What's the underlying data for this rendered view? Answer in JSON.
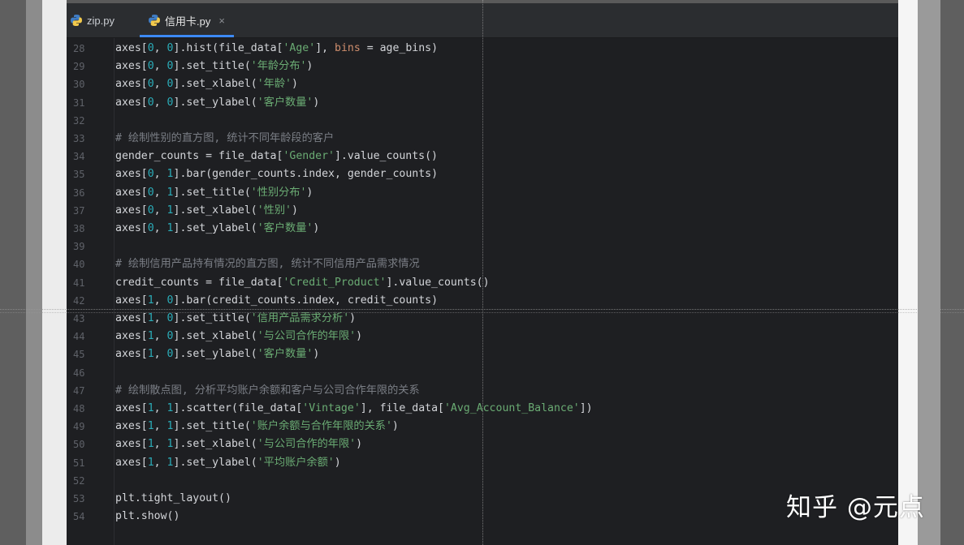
{
  "tabs": [
    {
      "label": "zip.py",
      "icon": "python-file-icon",
      "active": false
    },
    {
      "label": "信用卡.py",
      "icon": "python-file-icon",
      "active": true,
      "close": "×"
    }
  ],
  "colors": {
    "editor_bg": "#1e1f22",
    "number": "#2aacb8",
    "string": "#6aab73",
    "comment": "#7a7e85",
    "keyword_arg": "#cf8e6d",
    "active_tab_underline": "#3d8af7"
  },
  "code_lines": [
    {
      "n": "28",
      "t": [
        [
          "axes[",
          ""
        ],
        [
          "0",
          "n"
        ],
        [
          ", ",
          ""
        ],
        [
          "0",
          "n"
        ],
        [
          "].hist(file_data[",
          ""
        ],
        [
          "'Age'",
          "s"
        ],
        [
          "], ",
          ""
        ],
        [
          "bins",
          "kw"
        ],
        [
          " = age_bins)",
          ""
        ]
      ]
    },
    {
      "n": "29",
      "t": [
        [
          "axes[",
          ""
        ],
        [
          "0",
          "n"
        ],
        [
          ", ",
          ""
        ],
        [
          "0",
          "n"
        ],
        [
          "].set_title(",
          ""
        ],
        [
          "'年龄分布'",
          "s"
        ],
        [
          ")",
          ""
        ]
      ]
    },
    {
      "n": "30",
      "t": [
        [
          "axes[",
          ""
        ],
        [
          "0",
          "n"
        ],
        [
          ", ",
          ""
        ],
        [
          "0",
          "n"
        ],
        [
          "].set_xlabel(",
          ""
        ],
        [
          "'年龄'",
          "s"
        ],
        [
          ")",
          ""
        ]
      ]
    },
    {
      "n": "31",
      "t": [
        [
          "axes[",
          ""
        ],
        [
          "0",
          "n"
        ],
        [
          ", ",
          ""
        ],
        [
          "0",
          "n"
        ],
        [
          "].set_ylabel(",
          ""
        ],
        [
          "'客户数量'",
          "s"
        ],
        [
          ")",
          ""
        ]
      ]
    },
    {
      "n": "32",
      "t": []
    },
    {
      "n": "33",
      "t": [
        [
          "# 绘制性别的直方图, 统计不同年龄段的客户",
          "c"
        ]
      ]
    },
    {
      "n": "34",
      "t": [
        [
          "gender_counts = file_data[",
          ""
        ],
        [
          "'Gender'",
          "s"
        ],
        [
          "].value_counts()",
          ""
        ]
      ]
    },
    {
      "n": "35",
      "t": [
        [
          "axes[",
          ""
        ],
        [
          "0",
          "n"
        ],
        [
          ", ",
          ""
        ],
        [
          "1",
          "n"
        ],
        [
          "].bar(gender_counts.index, gender_counts)",
          ""
        ]
      ]
    },
    {
      "n": "36",
      "t": [
        [
          "axes[",
          ""
        ],
        [
          "0",
          "n"
        ],
        [
          ", ",
          ""
        ],
        [
          "1",
          "n"
        ],
        [
          "].set_title(",
          ""
        ],
        [
          "'性别分布'",
          "s"
        ],
        [
          ")",
          ""
        ]
      ]
    },
    {
      "n": "37",
      "t": [
        [
          "axes[",
          ""
        ],
        [
          "0",
          "n"
        ],
        [
          ", ",
          ""
        ],
        [
          "1",
          "n"
        ],
        [
          "].set_xlabel(",
          ""
        ],
        [
          "'性别'",
          "s"
        ],
        [
          ")",
          ""
        ]
      ]
    },
    {
      "n": "38",
      "t": [
        [
          "axes[",
          ""
        ],
        [
          "0",
          "n"
        ],
        [
          ", ",
          ""
        ],
        [
          "1",
          "n"
        ],
        [
          "].set_ylabel(",
          ""
        ],
        [
          "'客户数量'",
          "s"
        ],
        [
          ")",
          ""
        ]
      ]
    },
    {
      "n": "39",
      "t": []
    },
    {
      "n": "40",
      "t": [
        [
          "# 绘制信用产品持有情况的直方图, 统计不同信用产品需求情况",
          "c"
        ]
      ]
    },
    {
      "n": "41",
      "t": [
        [
          "credit_counts = file_data[",
          ""
        ],
        [
          "'Credit_Product'",
          "s"
        ],
        [
          "].value_counts()",
          ""
        ]
      ]
    },
    {
      "n": "42",
      "t": [
        [
          "axes[",
          ""
        ],
        [
          "1",
          "n"
        ],
        [
          ", ",
          ""
        ],
        [
          "0",
          "n"
        ],
        [
          "].bar(credit_counts.index, credit_counts)",
          ""
        ]
      ]
    },
    {
      "n": "43",
      "t": [
        [
          "axes[",
          ""
        ],
        [
          "1",
          "n"
        ],
        [
          ", ",
          ""
        ],
        [
          "0",
          "n"
        ],
        [
          "].set_title(",
          ""
        ],
        [
          "'信用产品需求分析'",
          "s"
        ],
        [
          ")",
          ""
        ]
      ]
    },
    {
      "n": "44",
      "t": [
        [
          "axes[",
          ""
        ],
        [
          "1",
          "n"
        ],
        [
          ", ",
          ""
        ],
        [
          "0",
          "n"
        ],
        [
          "].set_xlabel(",
          ""
        ],
        [
          "'与公司合作的年限'",
          "s"
        ],
        [
          ")",
          ""
        ]
      ]
    },
    {
      "n": "45",
      "t": [
        [
          "axes[",
          ""
        ],
        [
          "1",
          "n"
        ],
        [
          ", ",
          ""
        ],
        [
          "0",
          "n"
        ],
        [
          "].set_ylabel(",
          ""
        ],
        [
          "'客户数量'",
          "s"
        ],
        [
          ")",
          ""
        ]
      ]
    },
    {
      "n": "46",
      "t": []
    },
    {
      "n": "47",
      "t": [
        [
          "# 绘制散点图, 分析平均账户余额和客户与公司合作年限的关系",
          "c"
        ]
      ]
    },
    {
      "n": "48",
      "t": [
        [
          "axes[",
          ""
        ],
        [
          "1",
          "n"
        ],
        [
          ", ",
          ""
        ],
        [
          "1",
          "n"
        ],
        [
          "].scatter(file_data[",
          ""
        ],
        [
          "'Vintage'",
          "s"
        ],
        [
          "], file_data[",
          ""
        ],
        [
          "'Avg_Account_Balance'",
          "s"
        ],
        [
          "])",
          ""
        ]
      ]
    },
    {
      "n": "49",
      "t": [
        [
          "axes[",
          ""
        ],
        [
          "1",
          "n"
        ],
        [
          ", ",
          ""
        ],
        [
          "1",
          "n"
        ],
        [
          "].set_title(",
          ""
        ],
        [
          "'账户余额与合作年限的关系'",
          "s"
        ],
        [
          ")",
          ""
        ]
      ]
    },
    {
      "n": "50",
      "t": [
        [
          "axes[",
          ""
        ],
        [
          "1",
          "n"
        ],
        [
          ", ",
          ""
        ],
        [
          "1",
          "n"
        ],
        [
          "].set_xlabel(",
          ""
        ],
        [
          "'与公司合作的年限'",
          "s"
        ],
        [
          ")",
          ""
        ]
      ]
    },
    {
      "n": "51",
      "t": [
        [
          "axes[",
          ""
        ],
        [
          "1",
          "n"
        ],
        [
          ", ",
          ""
        ],
        [
          "1",
          "n"
        ],
        [
          "].set_ylabel(",
          ""
        ],
        [
          "'平均账户余额'",
          "s"
        ],
        [
          ")",
          ""
        ]
      ]
    },
    {
      "n": "52",
      "t": []
    },
    {
      "n": "53",
      "t": [
        [
          "plt.tight_layout()",
          ""
        ]
      ]
    },
    {
      "n": "54",
      "t": [
        [
          "plt.show()",
          ""
        ]
      ]
    }
  ],
  "watermark": "知乎 @元点"
}
